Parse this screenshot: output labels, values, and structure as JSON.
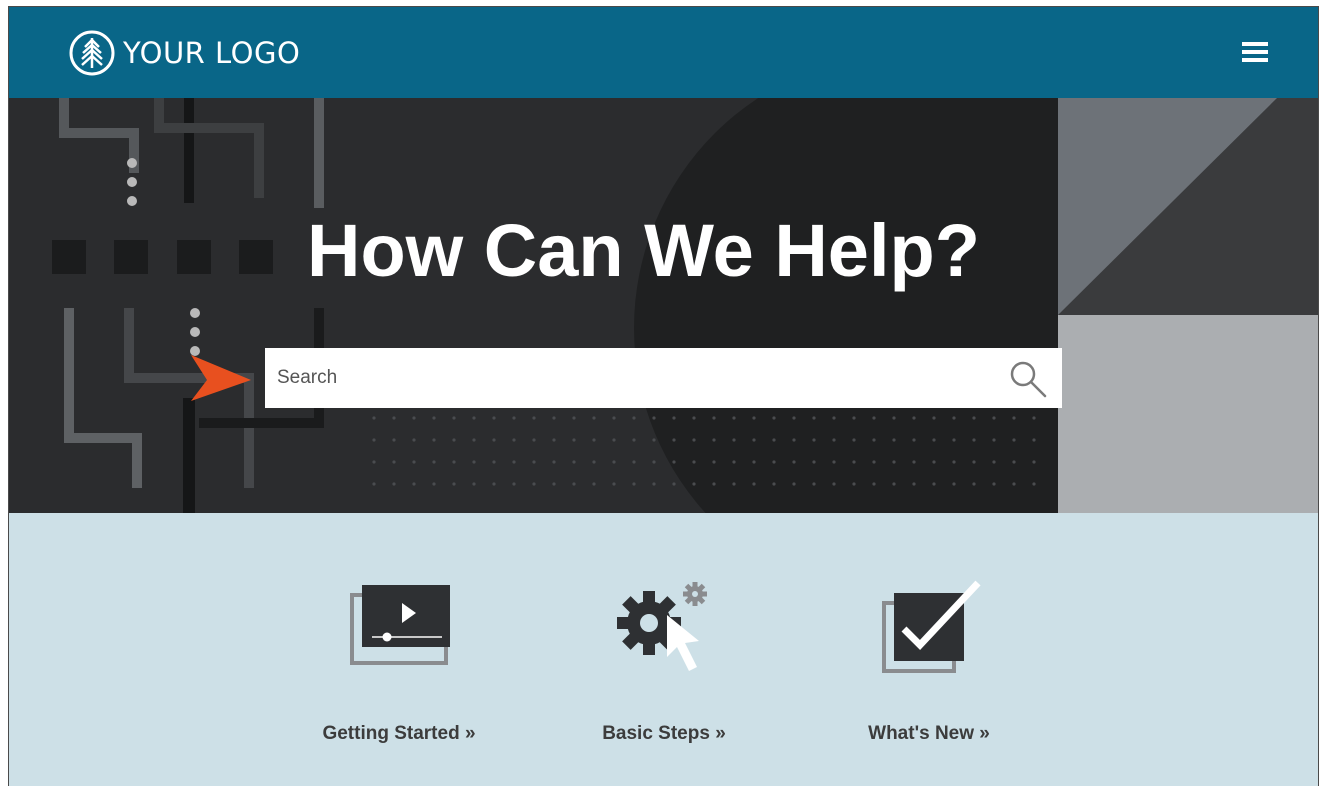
{
  "header": {
    "logo_text": "YOUR LOGO",
    "logo_icon": "tree-icon",
    "menu_icon": "hamburger-menu-icon",
    "bg_color": "#096688"
  },
  "hero": {
    "title": "How Can We Help?",
    "search_placeholder": "Search",
    "search_icon": "search-icon",
    "pointer_icon": "arrow-pointer-icon",
    "accent_color": "#e8501f"
  },
  "tiles": [
    {
      "label": "Getting Started »",
      "icon": "video-player-icon"
    },
    {
      "label": "Basic Steps »",
      "icon": "gear-cursor-icon"
    },
    {
      "label": "What's New »",
      "icon": "checkbox-icon"
    }
  ]
}
